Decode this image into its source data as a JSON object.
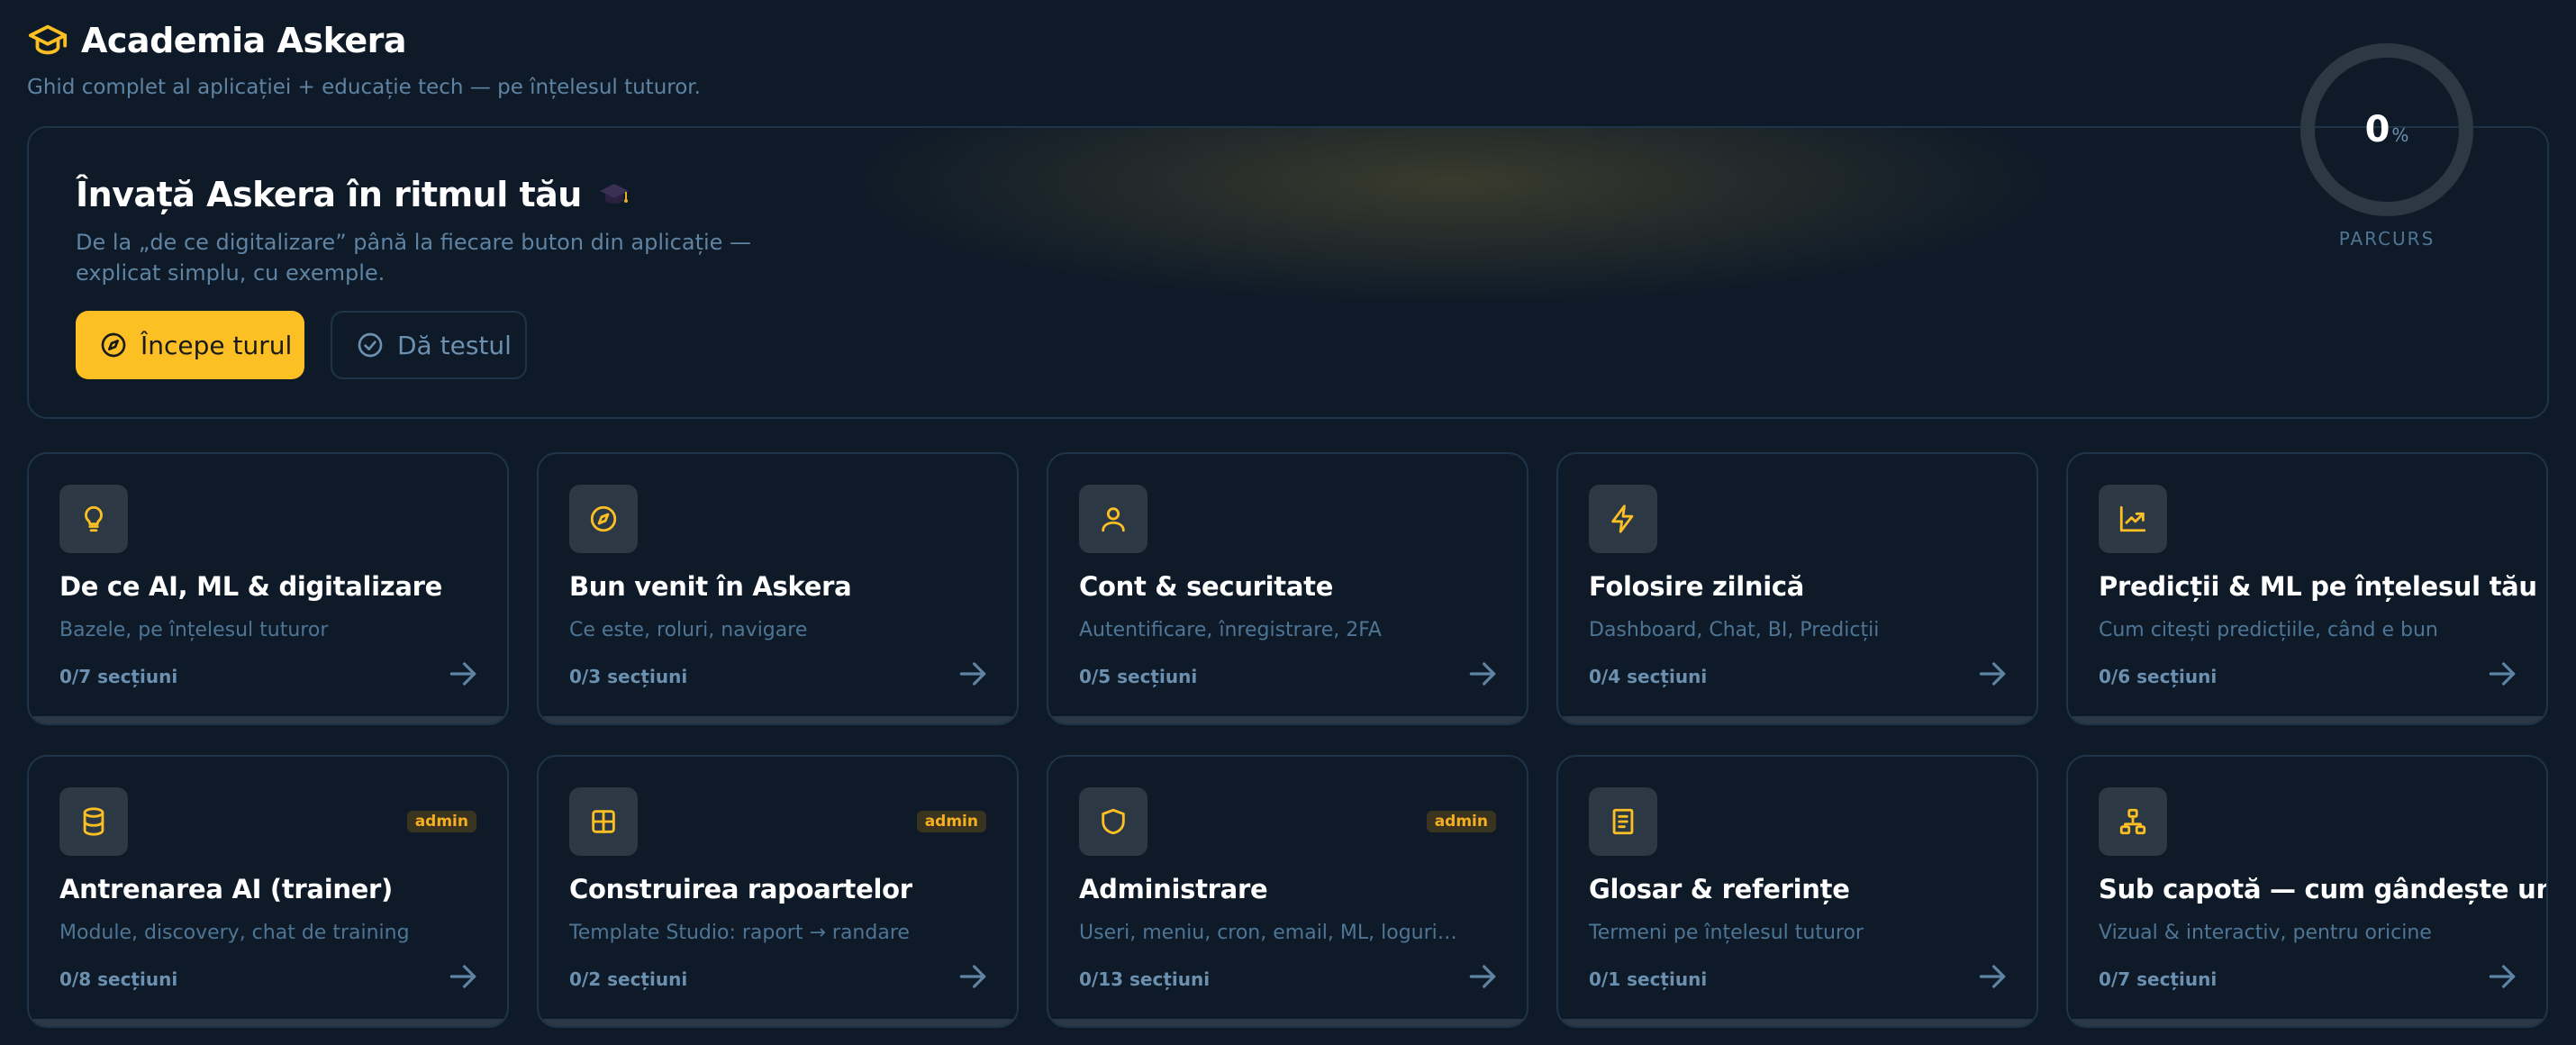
{
  "header": {
    "title": "Academia Askera",
    "subtitle": "Ghid complet al aplicației + educație tech — pe înțelesul tuturor.",
    "icon": "graduation-cap-icon"
  },
  "hero": {
    "title": "Învață Askera în ritmul tău",
    "emoji": "🎓",
    "description": "De la „de ce digitalizare” până la fiecare buton din aplicație — explicat simplu, cu exemple.",
    "start_button": "Începe turul",
    "test_button": "Dă testul",
    "progress_value": "0",
    "progress_unit": "%",
    "progress_label": "PARCURS"
  },
  "colors": {
    "accent": "#fcbf24",
    "background": "#0e1a28",
    "border": "#1e3448",
    "muted_text": "#5e83a3"
  },
  "cards": [
    {
      "title": "De ce AI, ML & digitalizare",
      "subtitle": "Bazele, pe înțelesul tuturor",
      "progress": "0/7 secțiuni",
      "icon": "lightbulb-icon",
      "badge": ""
    },
    {
      "title": "Bun venit în Askera",
      "subtitle": "Ce este, roluri, navigare",
      "progress": "0/3 secțiuni",
      "icon": "compass-icon",
      "badge": ""
    },
    {
      "title": "Cont & securitate",
      "subtitle": "Autentificare, înregistrare, 2FA",
      "progress": "0/5 secțiuni",
      "icon": "user-icon",
      "badge": ""
    },
    {
      "title": "Folosire zilnică",
      "subtitle": "Dashboard, Chat, BI, Predicții",
      "progress": "0/4 secțiuni",
      "icon": "lightning-icon",
      "badge": ""
    },
    {
      "title": "Predicții & ML pe înțelesul tău",
      "subtitle": "Cum citești predicțiile, când e bun",
      "progress": "0/6 secțiuni",
      "icon": "trending-chart-icon",
      "badge": ""
    },
    {
      "title": "Antrenarea AI (trainer)",
      "subtitle": "Module, discovery, chat de training",
      "progress": "0/8 secțiuni",
      "icon": "database-icon",
      "badge": "admin"
    },
    {
      "title": "Construirea rapoartelor",
      "subtitle": "Template Studio: raport → randare",
      "progress": "0/2 secțiuni",
      "icon": "layout-grid-icon",
      "badge": "admin"
    },
    {
      "title": "Administrare",
      "subtitle": "Useri, meniu, cron, email, ML, loguri…",
      "progress": "0/13 secțiuni",
      "icon": "shield-icon",
      "badge": "admin"
    },
    {
      "title": "Glosar & referințe",
      "subtitle": "Termeni pe înțelesul tuturor",
      "progress": "0/1 secțiuni",
      "icon": "book-icon",
      "badge": ""
    },
    {
      "title": "Sub capotă — cum gândește un AI",
      "subtitle": "Vizual & interactiv, pentru oricine",
      "progress": "0/7 secțiuni",
      "icon": "network-icon",
      "badge": ""
    }
  ]
}
